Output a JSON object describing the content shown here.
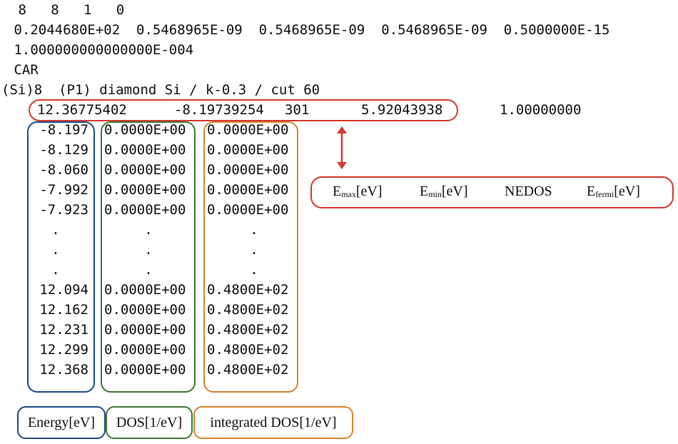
{
  "header_lines": [
    " 8   8   1   0",
    " 0.2044680E+02  0.5468965E-09  0.5468965E-09  0.5468965E-09  0.5000000E-15",
    " 1.000000000000000E-004",
    " CAR",
    "(Si)8  (P1) diamond Si / k-0.3 / cut 60"
  ],
  "summary_line": {
    "emax": "12.36775402",
    "emin": "-8.19739254",
    "nedos": "301",
    "efermi": "5.92043938",
    "weight": "1.00000000"
  },
  "energy": [
    "-8.197",
    "-8.129",
    "-8.060",
    "-7.992",
    "-7.923",
    ".",
    ".",
    ".",
    "12.094",
    "12.162",
    "12.231",
    "12.299",
    "12.368"
  ],
  "dos": [
    "0.0000E+00",
    "0.0000E+00",
    "0.0000E+00",
    "0.0000E+00",
    "0.0000E+00",
    ".",
    ".",
    ".",
    "0.0000E+00",
    "0.0000E+00",
    "0.0000E+00",
    "0.0000E+00",
    "0.0000E+00"
  ],
  "idos": [
    "0.0000E+00",
    "0.0000E+00",
    "0.0000E+00",
    "0.0000E+00",
    "0.0000E+00",
    ".",
    ".",
    ".",
    "0.4800E+02",
    "0.4800E+02",
    "0.4800E+02",
    "0.4800E+02",
    "0.4800E+02"
  ],
  "annotation": {
    "emax_main": "E",
    "emax_sub": "max",
    "emax_unit": "[eV]",
    "emin_main": "E",
    "emin_sub": "min",
    "emin_unit": "[eV]",
    "nedos": "NEDOS",
    "efermi_main": "E",
    "efermi_sub": "fermi",
    "efermi_unit": "[eV]"
  },
  "legend": {
    "energy": "Energy[eV]",
    "dos": "DOS[1/eV]",
    "idos": "integrated DOS[1/eV]"
  },
  "colors": {
    "red": "#d43a2f",
    "blue": "#1f4e8c",
    "green": "#3f7a34",
    "orange": "#d9852f"
  }
}
